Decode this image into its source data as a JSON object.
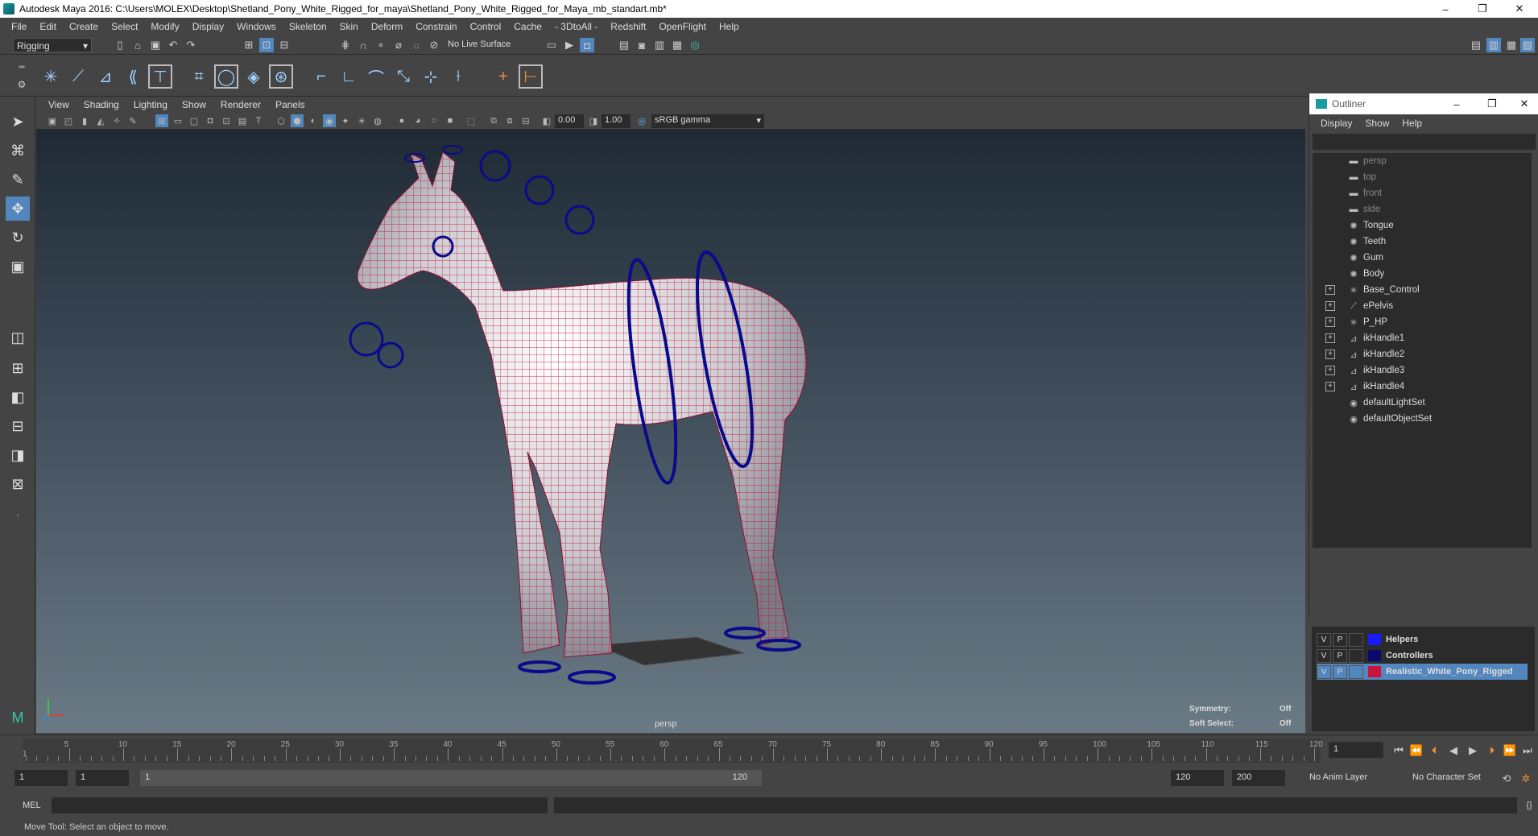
{
  "window": {
    "title": "Autodesk Maya 2016: C:\\Users\\MOLEX\\Desktop\\Shetland_Pony_White_Rigged_for_maya\\Shetland_Pony_White_Rigged_for_Maya_mb_standart.mb*",
    "minimize": "–",
    "maximize": "❐",
    "close": "✕"
  },
  "menubar": [
    "File",
    "Edit",
    "Create",
    "Select",
    "Modify",
    "Display",
    "Windows",
    "Skeleton",
    "Skin",
    "Deform",
    "Constrain",
    "Control",
    "Cache",
    "- 3DtoAll -",
    "Redshift",
    "OpenFlight",
    "Help"
  ],
  "statusline": {
    "menuset": "Rigging",
    "live_surface": "No Live Surface"
  },
  "viewport": {
    "menus": [
      "View",
      "Shading",
      "Lighting",
      "Show",
      "Renderer",
      "Panels"
    ],
    "exposure": "0.00",
    "gamma": "1.00",
    "colorspace": "sRGB gamma",
    "camera_label": "persp",
    "symmetry_label": "Symmetry:",
    "symmetry_value": "Off",
    "soft_select_label": "Soft Select:",
    "soft_select_value": "Off"
  },
  "outliner": {
    "title": "Outliner",
    "menus": [
      "Display",
      "Show",
      "Help"
    ],
    "items": [
      {
        "label": "persp",
        "icon": "camera-icon",
        "expandable": false,
        "dim": true
      },
      {
        "label": "top",
        "icon": "camera-icon",
        "expandable": false,
        "dim": true
      },
      {
        "label": "front",
        "icon": "camera-icon",
        "expandable": false,
        "dim": true
      },
      {
        "label": "side",
        "icon": "camera-icon",
        "expandable": false,
        "dim": true
      },
      {
        "label": "Tongue",
        "icon": "mesh-icon",
        "expandable": false,
        "dim": false
      },
      {
        "label": "Teeth",
        "icon": "mesh-icon",
        "expandable": false,
        "dim": false
      },
      {
        "label": "Gum",
        "icon": "mesh-icon",
        "expandable": false,
        "dim": false
      },
      {
        "label": "Body",
        "icon": "mesh-icon",
        "expandable": false,
        "dim": false
      },
      {
        "label": "Base_Control",
        "icon": "locator-icon",
        "expandable": true,
        "dim": false
      },
      {
        "label": "ePelvis",
        "icon": "joint-icon",
        "expandable": true,
        "dim": false
      },
      {
        "label": "P_HP",
        "icon": "locator-icon",
        "expandable": true,
        "dim": false
      },
      {
        "label": "ikHandle1",
        "icon": "ik-handle-icon",
        "expandable": true,
        "dim": false
      },
      {
        "label": "ikHandle2",
        "icon": "ik-handle-icon",
        "expandable": true,
        "dim": false
      },
      {
        "label": "ikHandle3",
        "icon": "ik-handle-icon",
        "expandable": true,
        "dim": false
      },
      {
        "label": "ikHandle4",
        "icon": "ik-handle-icon",
        "expandable": true,
        "dim": false
      },
      {
        "label": "defaultLightSet",
        "icon": "set-icon",
        "expandable": false,
        "dim": false
      },
      {
        "label": "defaultObjectSet",
        "icon": "set-icon",
        "expandable": false,
        "dim": false
      }
    ]
  },
  "layers": [
    {
      "v": "V",
      "p": "P",
      "name": "Helpers",
      "color": "#1a1aff",
      "active": false
    },
    {
      "v": "V",
      "p": "P",
      "name": "Controllers",
      "color": "#0a0a6e",
      "active": false
    },
    {
      "v": "V",
      "p": "P",
      "name": "Realistic_White_Pony_Rigged",
      "color": "#c8143c",
      "active": true
    }
  ],
  "timeline": {
    "ticks": [
      "5",
      "10",
      "15",
      "20",
      "25",
      "30",
      "35",
      "40",
      "45",
      "50",
      "55",
      "60",
      "65",
      "70",
      "75",
      "80",
      "85",
      "90",
      "95",
      "100",
      "105",
      "110",
      "115",
      "120"
    ],
    "start_tick": "1",
    "current_frame": "1"
  },
  "range": {
    "start": "1",
    "playback_start": "1",
    "slider_start": "1",
    "slider_end": "120",
    "playback_end": "120",
    "end": "200",
    "anim_layer": "No Anim Layer",
    "character_set": "No Character Set"
  },
  "cmdline": {
    "label": "MEL"
  },
  "helpline": "Move Tool: Select an object to move."
}
